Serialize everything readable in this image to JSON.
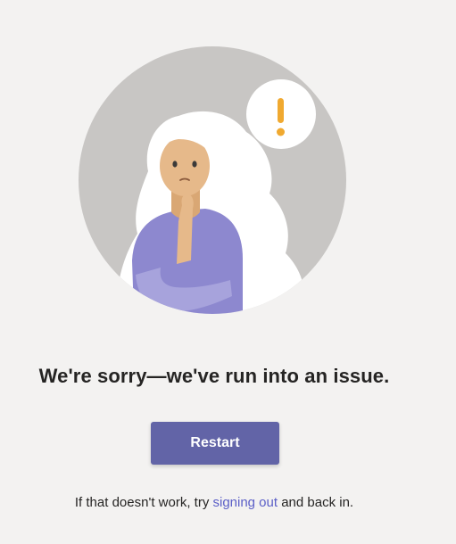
{
  "error_page": {
    "illustration_icon": "confused-person-illustration",
    "thought_bubble_icon": "exclamation-icon",
    "headline": "We're sorry—we've run into an issue.",
    "restart_label": "Restart",
    "help_prefix": "If that doesn't work, try ",
    "help_link": "signing out",
    "help_suffix": " and back in."
  },
  "colors": {
    "background": "#f3f2f1",
    "accent": "#6264a7",
    "link": "#5b5fc7",
    "warning": "#f0a930"
  }
}
